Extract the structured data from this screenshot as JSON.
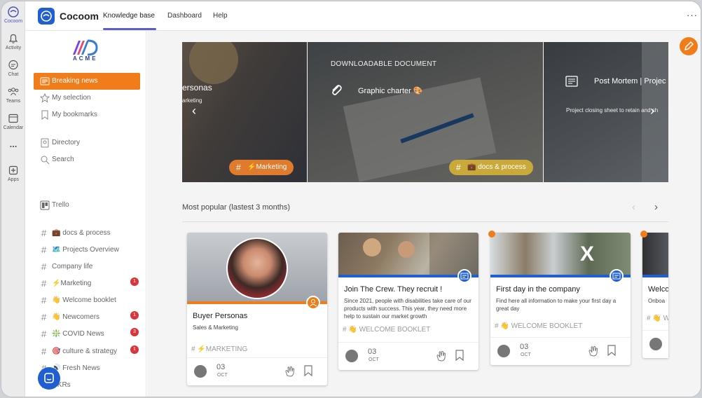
{
  "rail": {
    "items": [
      {
        "label": "Cocoom",
        "icon": "cocoom-icon"
      },
      {
        "label": "Activity",
        "icon": "bell-icon"
      },
      {
        "label": "Chat",
        "icon": "chat-icon"
      },
      {
        "label": "Teams",
        "icon": "teams-icon"
      },
      {
        "label": "Calendar",
        "icon": "calendar-icon"
      },
      {
        "label": "...",
        "icon": "more-icon"
      },
      {
        "label": "Apps",
        "icon": "apps-icon"
      }
    ]
  },
  "topbar": {
    "app_title": "Cocoom",
    "tabs": [
      {
        "label": "Knowledge base",
        "active": true
      },
      {
        "label": "Dashboard"
      },
      {
        "label": "Help"
      }
    ],
    "more": "···"
  },
  "sidebar": {
    "brand": "ACME",
    "nav": [
      {
        "label": "Breaking news",
        "icon": "newspaper-icon",
        "active": true
      },
      {
        "label": "My selection",
        "icon": "star-icon"
      },
      {
        "label": "My bookmarks",
        "icon": "bookmark-icon"
      },
      {
        "label": "Directory",
        "icon": "contacts-icon"
      },
      {
        "label": "Search",
        "icon": "search-icon"
      },
      {
        "label": "Trello",
        "icon": "trello-icon"
      }
    ],
    "channels": [
      {
        "label": "💼 docs & process"
      },
      {
        "label": "🗺️ Projects Overview"
      },
      {
        "label": "Company life"
      },
      {
        "label": "⚡Marketing",
        "badge": "1"
      },
      {
        "label": "👋 Welcome booklet"
      },
      {
        "label": "👋 Newcomers",
        "badge": "1"
      },
      {
        "label": "❇️ COVID News",
        "badge": "3"
      },
      {
        "label": "🎯 culture & strategy",
        "badge": "1"
      },
      {
        "label": "🔊 Fresh News"
      },
      {
        "label": "OKRs"
      }
    ]
  },
  "carousel": {
    "slides": [
      {
        "title": "ersonas",
        "subtitle": "arketing",
        "tag": "⚡Marketing"
      },
      {
        "kicker": "DOWNLOADABLE DOCUMENT",
        "title": "Graphic charter 🎨",
        "tag": "💼 docs & process"
      },
      {
        "title": "Post Mortem | Projec",
        "subtitle": "Project closing sheet to retain and sh"
      }
    ]
  },
  "popular": {
    "title": "Most popular (lastest 3 months)",
    "cards": [
      {
        "title": "Buyer Personas",
        "subtitle": "Sales & Marketing",
        "tag": "⚡MARKETING",
        "day": "03",
        "month": "OCT"
      },
      {
        "title": "Join The Crew. They recruit !",
        "subtitle": "Since 2021, people with disabilities take care of our products with success. This year, they need more help to sustain our market growth",
        "tag": "👋 WELCOME BOOKLET",
        "day": "03",
        "month": "OCT"
      },
      {
        "title": "First day in the company",
        "subtitle": "Find here all information to make your first day a great day",
        "tag": "👋 WELCOME BOOKLET",
        "day": "03",
        "month": "OCT"
      },
      {
        "title": "Welco",
        "subtitle": "Onboa",
        "tag": "👋 W"
      }
    ]
  },
  "colors": {
    "accent": "#f07d1a",
    "brand": "#1f5fd1",
    "teams": "#5b5fc7"
  }
}
